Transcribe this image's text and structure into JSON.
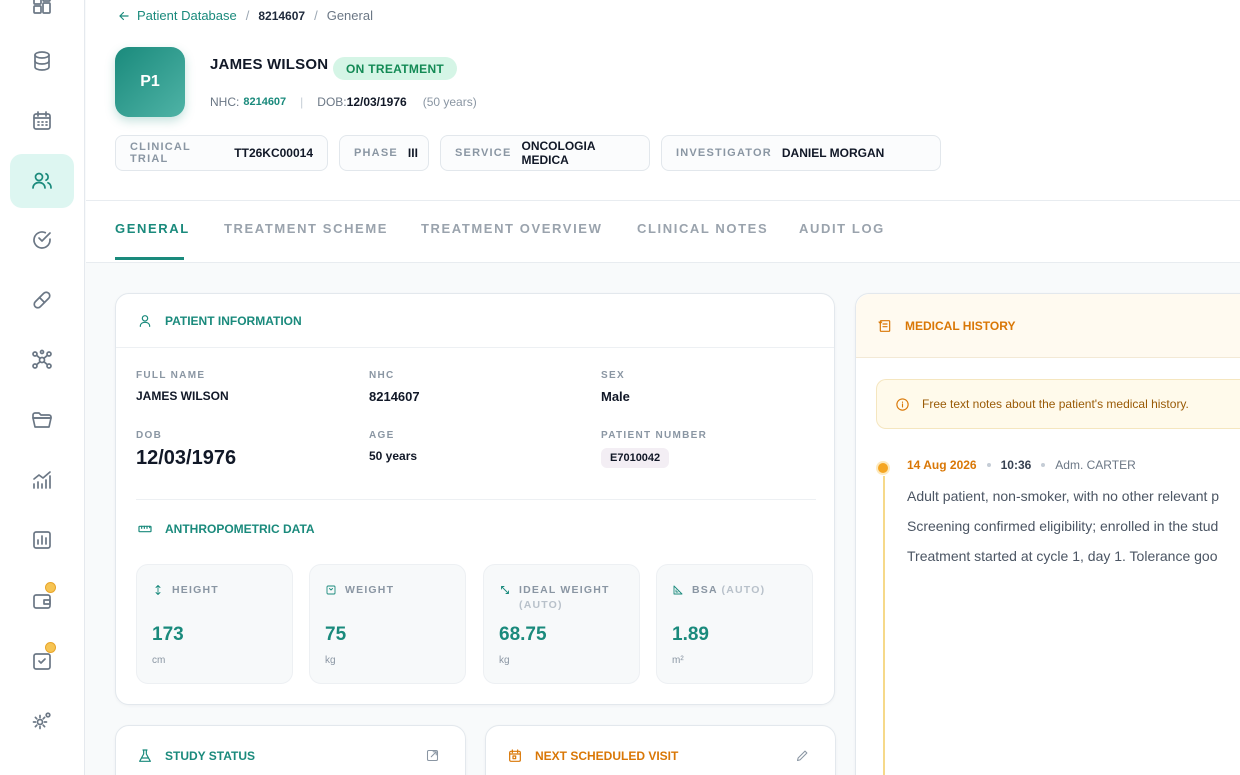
{
  "sidebar": {
    "items": [
      {
        "icon": "dashboard-icon",
        "active": false
      },
      {
        "icon": "database-icon",
        "active": false
      },
      {
        "icon": "calendar-icon",
        "active": false
      },
      {
        "icon": "users-icon",
        "active": true
      },
      {
        "icon": "check-circle-icon",
        "active": false
      },
      {
        "icon": "pill-icon",
        "active": false
      },
      {
        "icon": "network-icon",
        "active": false
      },
      {
        "icon": "folder-icon",
        "active": false
      },
      {
        "icon": "trend-chart-icon",
        "active": false
      },
      {
        "icon": "bar-chart-icon",
        "active": false
      },
      {
        "icon": "wallet-icon",
        "active": false,
        "badge": true
      },
      {
        "icon": "clipboard-check-icon",
        "active": false,
        "badge": true
      },
      {
        "icon": "settings-icon",
        "active": false
      }
    ]
  },
  "breadcrumb": {
    "back_label": "Patient Database",
    "patient_id": "8214607",
    "current": "General"
  },
  "patient": {
    "initials": "P1",
    "name": "JAMES WILSON",
    "status": "ON TREATMENT",
    "nhc_label": "NHC:",
    "nhc": "8214607",
    "dob_label": "DOB:",
    "dob": "12/03/1976",
    "age_text": "(50 years)"
  },
  "chips": [
    {
      "key": "CLINICAL TRIAL",
      "value": "TT26KC00014"
    },
    {
      "key": "PHASE",
      "value": "III"
    },
    {
      "key": "SERVICE",
      "value": "ONCOLOGIA MEDICA"
    },
    {
      "key": "INVESTIGATOR",
      "value": "DANIEL MORGAN"
    }
  ],
  "tabs": [
    {
      "label": "GENERAL",
      "active": true
    },
    {
      "label": "TREATMENT SCHEME",
      "active": false
    },
    {
      "label": "TREATMENT OVERVIEW",
      "active": false
    },
    {
      "label": "CLINICAL NOTES",
      "active": false
    },
    {
      "label": "AUDIT LOG",
      "active": false
    }
  ],
  "patient_info": {
    "title": "PATIENT INFORMATION",
    "full_name_label": "FULL NAME",
    "full_name": "JAMES WILSON",
    "nhc_label": "NHC",
    "nhc": "8214607",
    "sex_label": "SEX",
    "sex": "Male",
    "dob_label": "DOB",
    "dob": "12/03/1976",
    "age_label": "AGE",
    "age": "50 years",
    "patient_number_label": "PATIENT NUMBER",
    "patient_number": "E7010042"
  },
  "anthropometric": {
    "title": "ANTHROPOMETRIC DATA",
    "metrics": [
      {
        "label": "HEIGHT",
        "auto": "",
        "value": "173",
        "unit": "cm",
        "icon": "height-arrows-icon"
      },
      {
        "label": "WEIGHT",
        "auto": "",
        "value": "75",
        "unit": "kg",
        "icon": "scale-icon"
      },
      {
        "label": "IDEAL WEIGHT",
        "auto": "(AUTO)",
        "value": "68.75",
        "unit": "kg",
        "icon": "diagonal-arrows-icon"
      },
      {
        "label": "BSA",
        "auto": "(AUTO)",
        "value": "1.89",
        "unit": "m²",
        "icon": "triangle-ruler-icon"
      }
    ]
  },
  "study_status": {
    "title": "STUDY STATUS"
  },
  "next_visit": {
    "title": "NEXT SCHEDULED VISIT"
  },
  "medical_history": {
    "title": "MEDICAL HISTORY",
    "note": "Free text notes about the patient's medical history.",
    "entry": {
      "date": "14 Aug 2026",
      "time": "10:36",
      "author": "Adm. CARTER",
      "lines": [
        "Adult patient, non-smoker, with no other relevant p",
        "Screening confirmed eligibility; enrolled in the stud",
        "Treatment started at cycle 1, day 1. Tolerance goo"
      ]
    }
  },
  "colors": {
    "accent": "#1a8a7c",
    "status_green_bg": "#d5f5e6",
    "history_orange": "#d97706",
    "sidebar_active_bg": "#ddf6f1"
  }
}
